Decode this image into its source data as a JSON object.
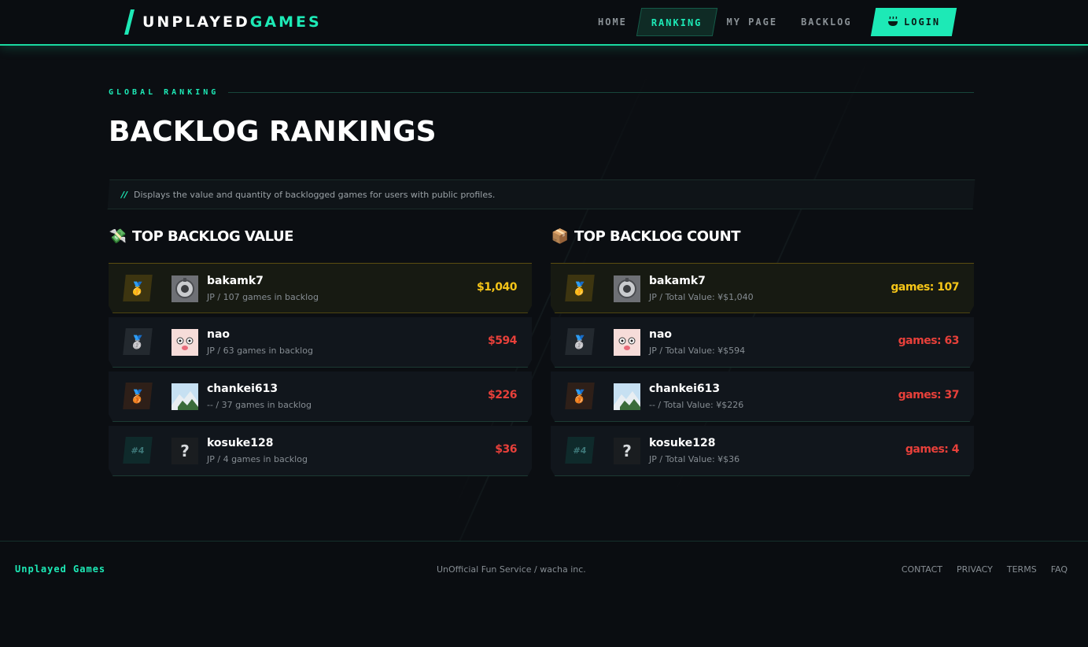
{
  "brand": {
    "part1": "UNPLAYED",
    "part2": "GAMES",
    "accent": "#1de9b6"
  },
  "nav": {
    "items": [
      {
        "label": "HOME"
      },
      {
        "label": "RANKING",
        "active": true
      },
      {
        "label": "MY PAGE"
      },
      {
        "label": "BACKLOG"
      }
    ],
    "login_label": "LOGIN",
    "login_icon": "steam-icon"
  },
  "page": {
    "eyebrow": "GLOBAL RANKING",
    "title": "BACKLOG RANKINGS",
    "notice_icon": "//",
    "notice": "Displays the value and quantity of backlogged games for users with public profiles."
  },
  "value_ranking": {
    "emoji": "💸",
    "title": "TOP BACKLOG VALUE",
    "rows": [
      {
        "rank_icon": "🥇",
        "rank_type": "gold",
        "avatar": "robot",
        "name": "bakamk7",
        "sub": "JP / 107 games in backlog",
        "score": "$1,040",
        "score_color": "gold"
      },
      {
        "rank_icon": "🥈",
        "rank_type": "silver",
        "avatar": "pink",
        "name": "nao",
        "sub": "JP / 63 games in backlog",
        "score": "$594",
        "score_color": "red"
      },
      {
        "rank_icon": "🥉",
        "rank_type": "bronze",
        "avatar": "mountain",
        "name": "chankei613",
        "sub": "-- / 37 games in backlog",
        "score": "$226",
        "score_color": "red"
      },
      {
        "rank_icon": "#4",
        "rank_type": "rank",
        "avatar": "unknown",
        "avatar_text": "?",
        "name": "kosuke128",
        "sub": "JP / 4 games in backlog",
        "score": "$36",
        "score_color": "red"
      }
    ]
  },
  "count_ranking": {
    "emoji": "📦",
    "title": "TOP BACKLOG COUNT",
    "rows": [
      {
        "rank_icon": "🥇",
        "rank_type": "gold",
        "avatar": "robot",
        "name": "bakamk7",
        "sub": "JP / Total Value: ¥$1,040",
        "score": "games: 107",
        "score_color": "gold"
      },
      {
        "rank_icon": "🥈",
        "rank_type": "silver",
        "avatar": "pink",
        "name": "nao",
        "sub": "JP / Total Value: ¥$594",
        "score": "games: 63",
        "score_color": "red"
      },
      {
        "rank_icon": "🥉",
        "rank_type": "bronze",
        "avatar": "mountain",
        "name": "chankei613",
        "sub": "-- / Total Value: ¥$226",
        "score": "games: 37",
        "score_color": "red"
      },
      {
        "rank_icon": "#4",
        "rank_type": "rank",
        "avatar": "unknown",
        "avatar_text": "?",
        "name": "kosuke128",
        "sub": "JP / Total Value: ¥$36",
        "score": "games: 4",
        "score_color": "red"
      }
    ]
  },
  "footer": {
    "brand": "Unplayed Games",
    "center": "UnOfficial Fun Service / wacha inc.",
    "links": [
      "CONTACT",
      "PRIVACY",
      "TERMS",
      "FAQ"
    ]
  },
  "colors": {
    "gold": "#f5c518",
    "red": "#e8403a",
    "bg": "#0b0e12"
  }
}
